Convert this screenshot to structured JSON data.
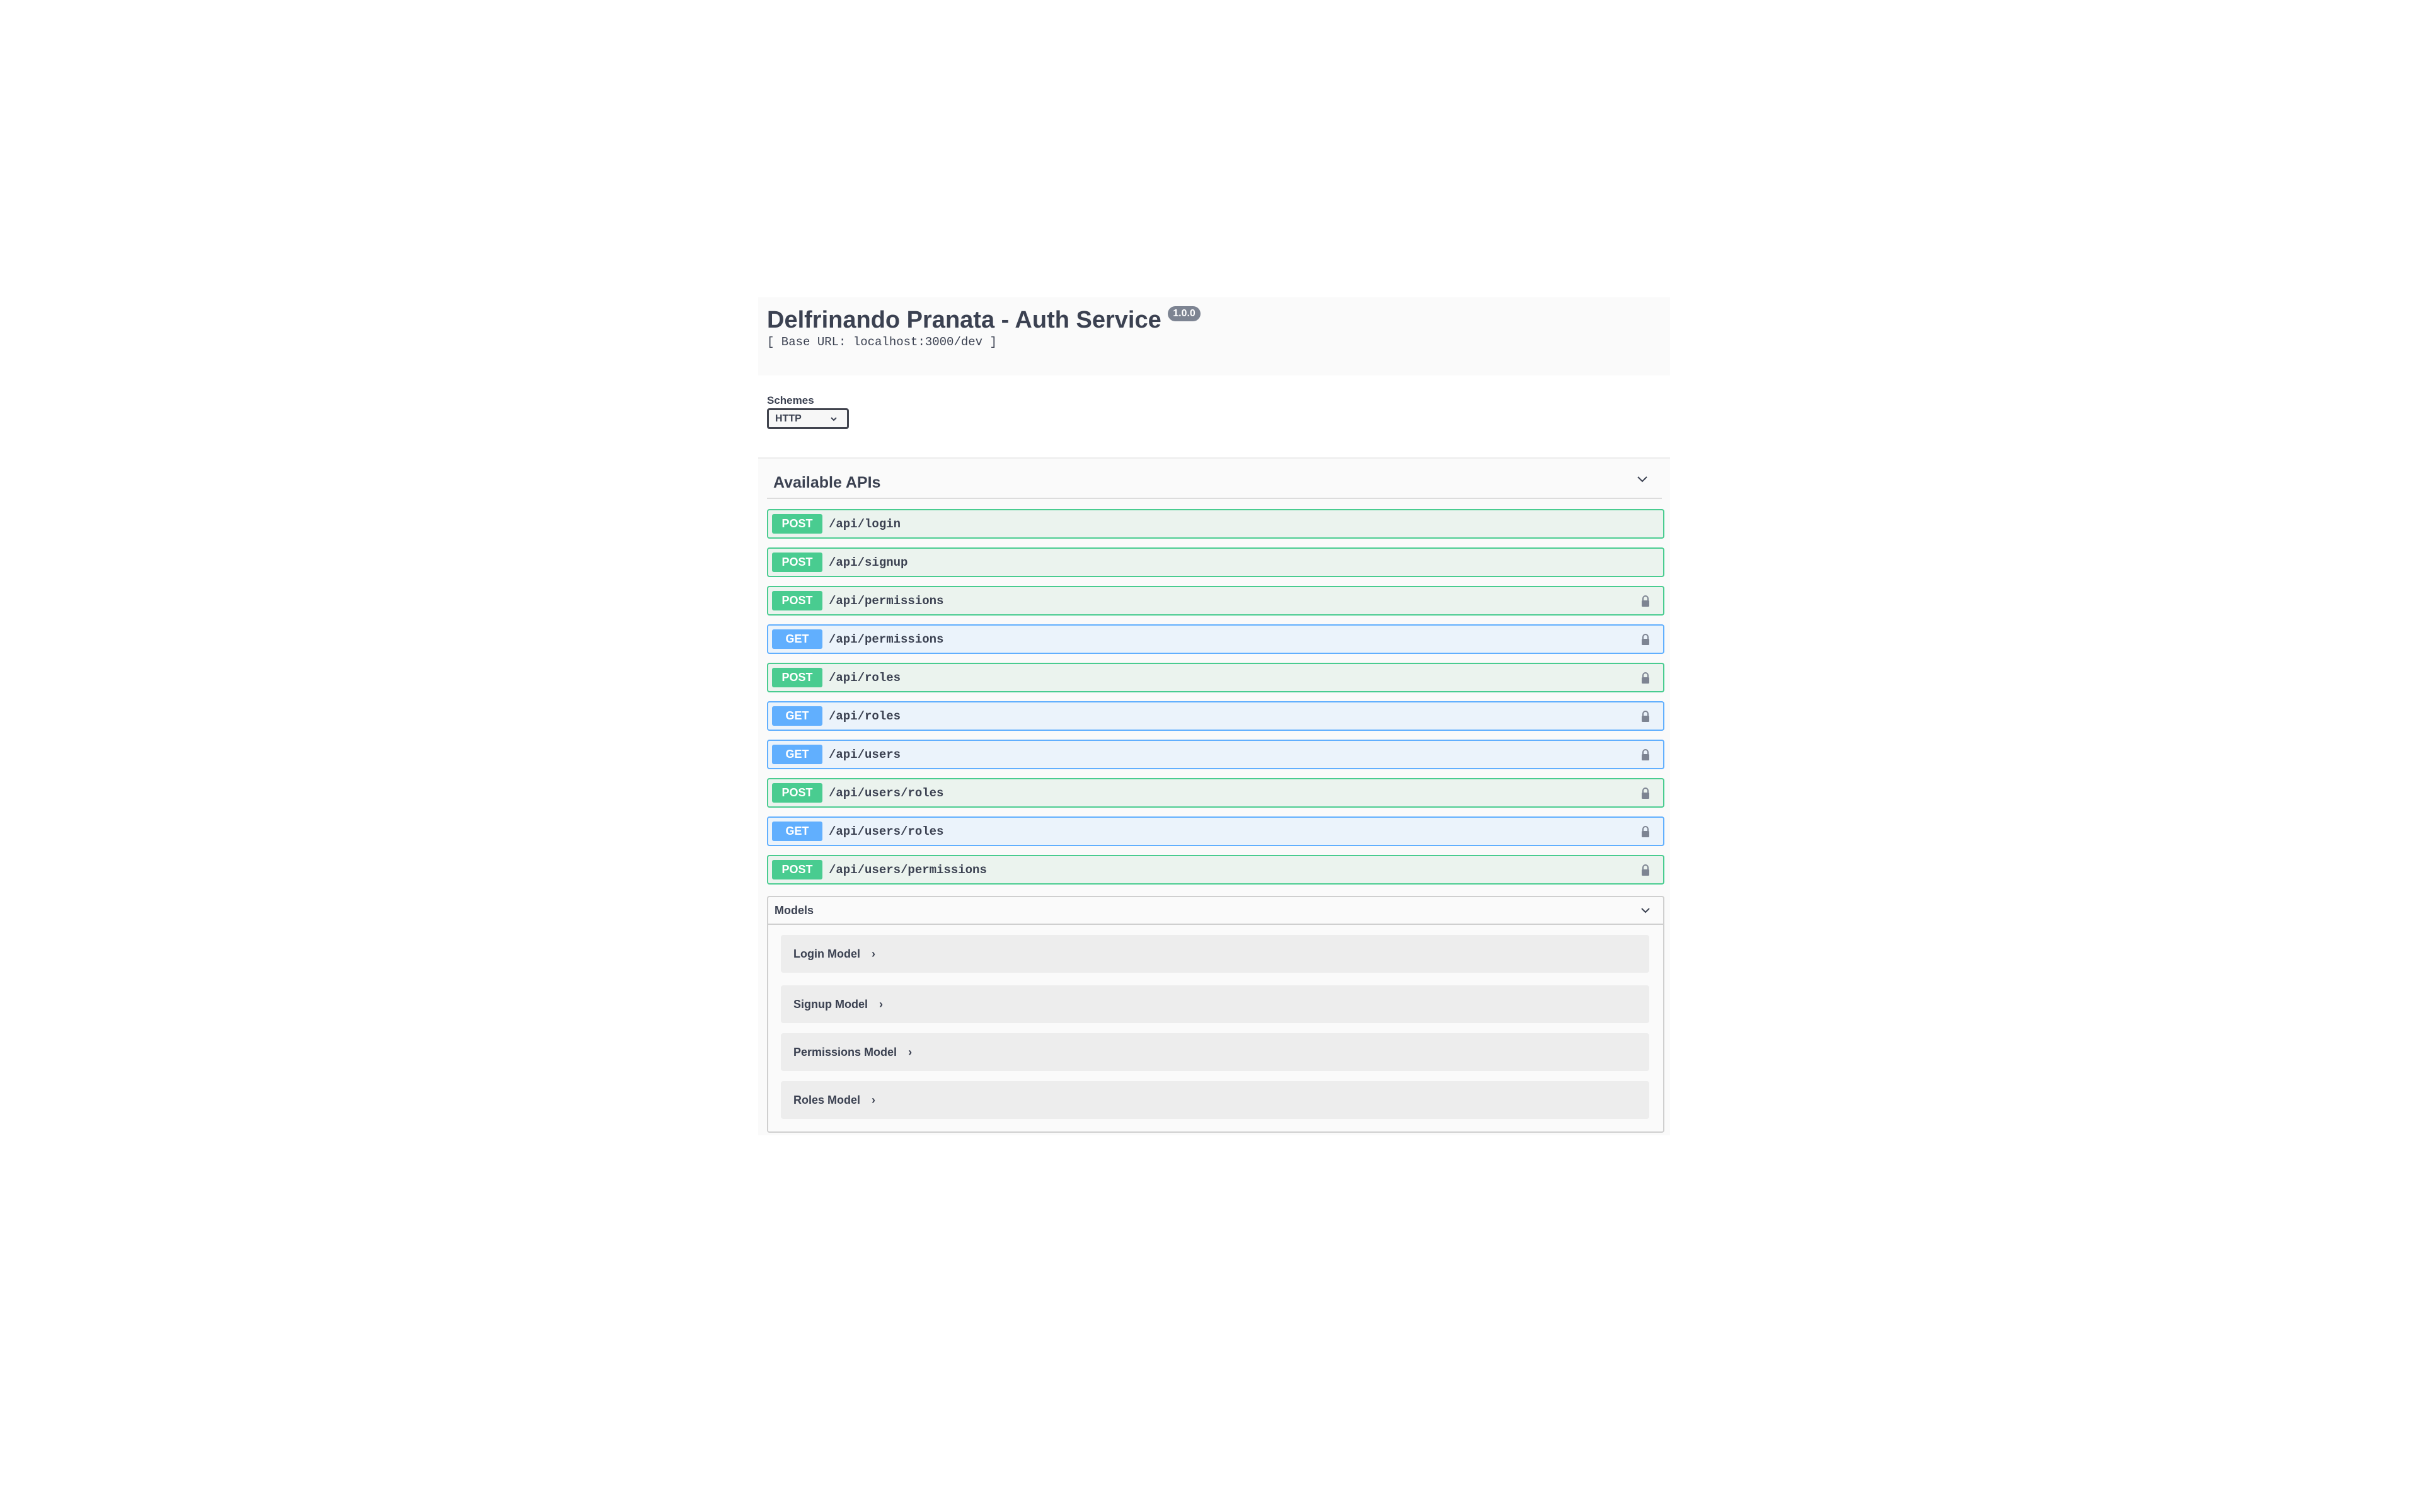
{
  "info": {
    "title": "Delfrinando Pranata - Auth Service",
    "version": "1.0.0",
    "base_url": "[ Base URL: localhost:3000/dev ]"
  },
  "schemes": {
    "label": "Schemes",
    "selected": "HTTP"
  },
  "section": {
    "title": "Available APIs"
  },
  "operations": [
    {
      "method": "POST",
      "path": "/api/login",
      "locked": false
    },
    {
      "method": "POST",
      "path": "/api/signup",
      "locked": false
    },
    {
      "method": "POST",
      "path": "/api/permissions",
      "locked": true
    },
    {
      "method": "GET",
      "path": "/api/permissions",
      "locked": true
    },
    {
      "method": "POST",
      "path": "/api/roles",
      "locked": true
    },
    {
      "method": "GET",
      "path": "/api/roles",
      "locked": true
    },
    {
      "method": "GET",
      "path": "/api/users",
      "locked": true
    },
    {
      "method": "POST",
      "path": "/api/users/roles",
      "locked": true
    },
    {
      "method": "GET",
      "path": "/api/users/roles",
      "locked": true
    },
    {
      "method": "POST",
      "path": "/api/users/permissions",
      "locked": true
    }
  ],
  "models": {
    "title": "Models",
    "items": [
      {
        "name": "Login Model"
      },
      {
        "name": "Signup Model"
      },
      {
        "name": "Permissions Model"
      },
      {
        "name": "Roles Model"
      }
    ]
  },
  "colors": {
    "post": "#49cc90",
    "get": "#61affe"
  }
}
